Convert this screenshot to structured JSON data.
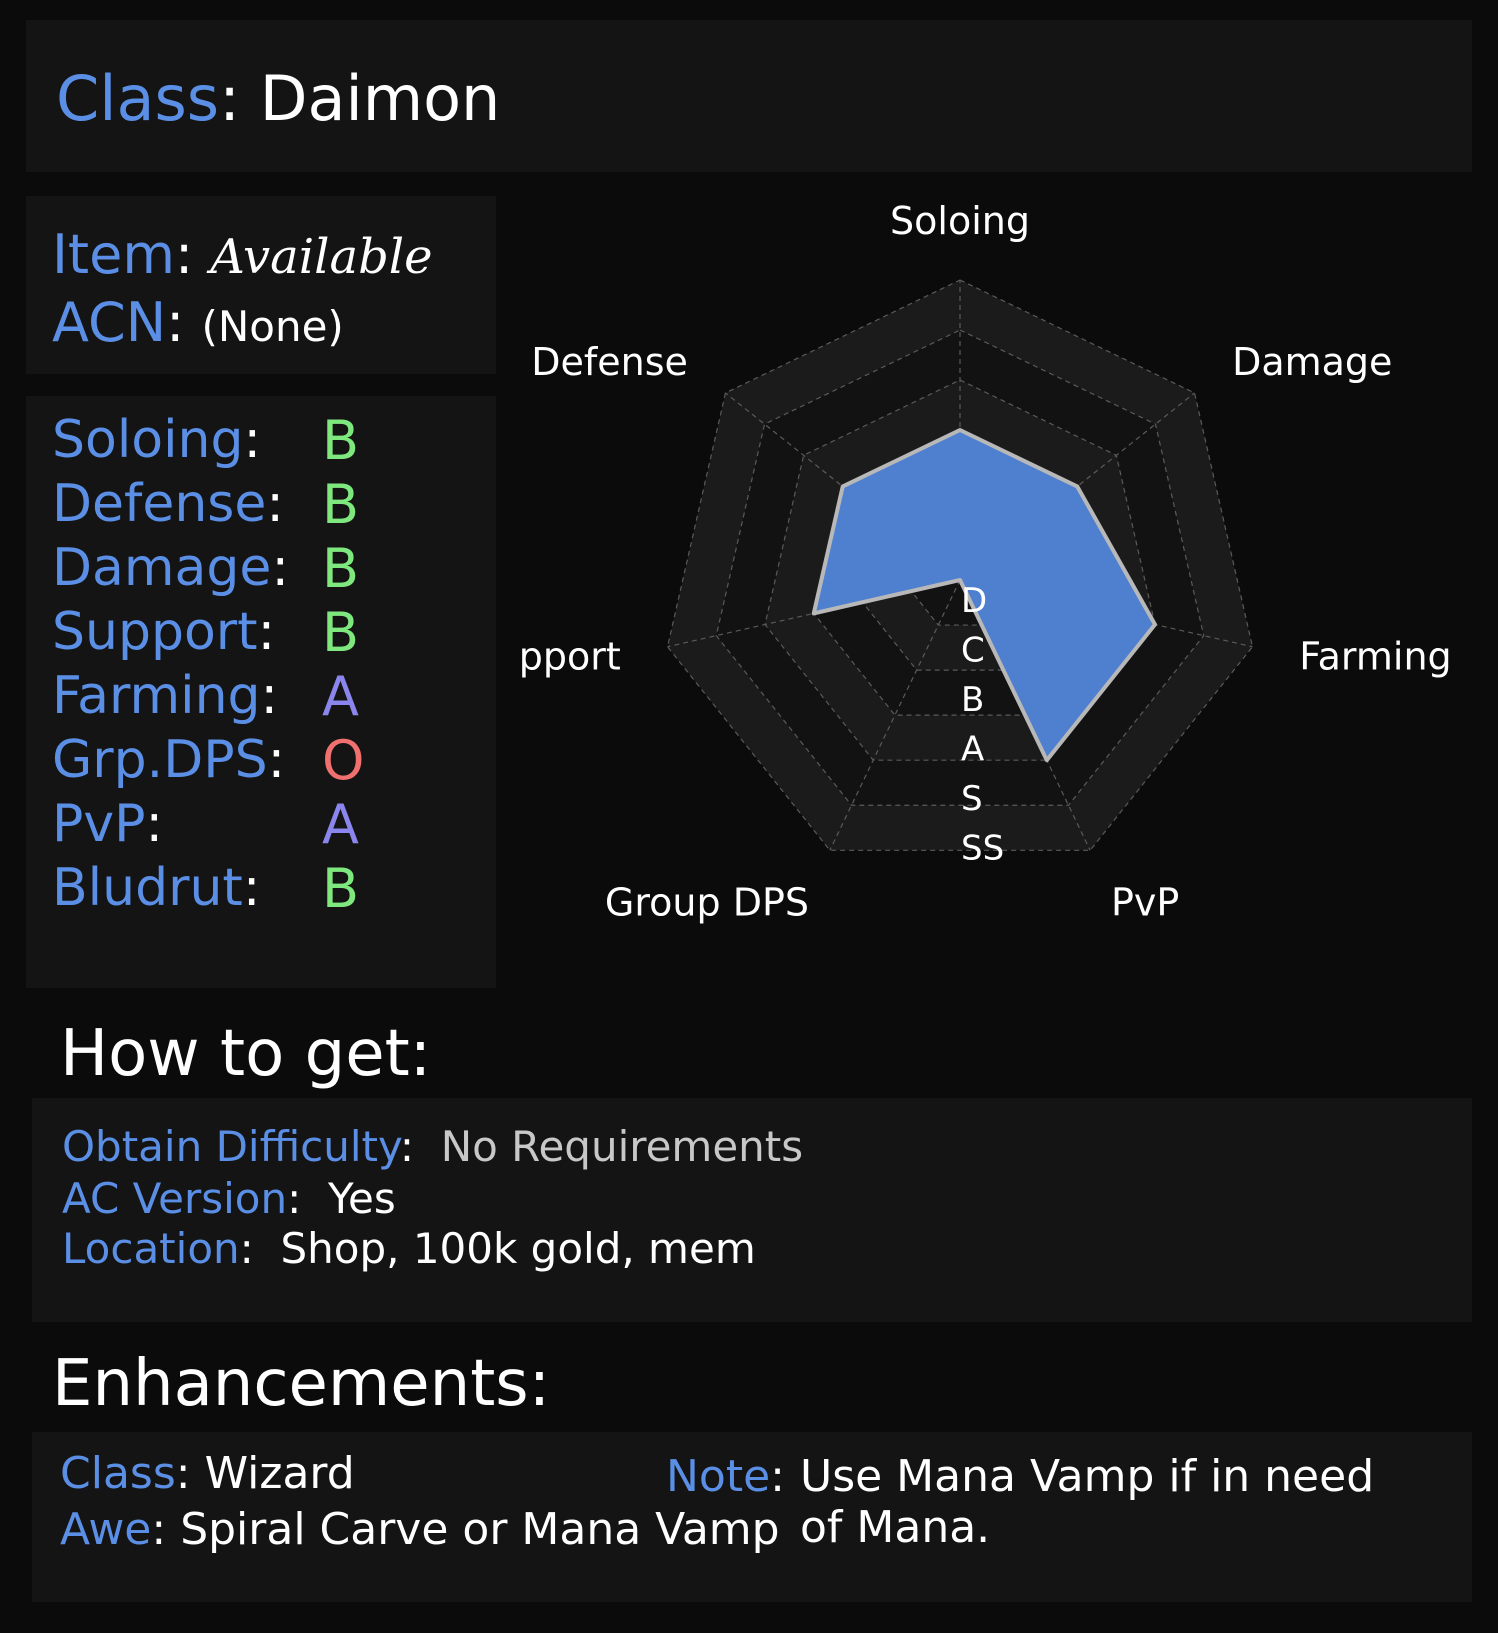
{
  "header": {
    "class_label": "Class",
    "class_value": "Daimon"
  },
  "item": {
    "item_label": "Item",
    "item_value": "Available",
    "acn_label": "ACN",
    "acn_value": "(None)"
  },
  "ratings": [
    {
      "label": "Soloing",
      "grade": "B",
      "color": "#7ee87e"
    },
    {
      "label": "Defense",
      "grade": "B",
      "color": "#7ee87e"
    },
    {
      "label": "Damage",
      "grade": "B",
      "color": "#7ee87e"
    },
    {
      "label": "Support",
      "grade": "B",
      "color": "#7ee87e"
    },
    {
      "label": "Farming",
      "grade": "A",
      "color": "#8a86ee"
    },
    {
      "label": "Grp.DPS",
      "grade": "O",
      "color": "#f07070"
    },
    {
      "label": "PvP",
      "grade": "A",
      "color": "#8a86ee"
    },
    {
      "label": "Bludrut",
      "grade": "B",
      "color": "#7ee87e"
    }
  ],
  "chart_data": {
    "type": "radar",
    "axes": [
      "Soloing",
      "Damage",
      "Farming",
      "PvP",
      "Group DPS",
      "Support",
      "Defense"
    ],
    "scale_labels": [
      "D",
      "C",
      "B",
      "A",
      "S",
      "SS"
    ],
    "values": [
      3,
      3,
      4,
      4,
      0,
      3,
      3
    ],
    "max": 6,
    "fill_color": "#4f7fcf",
    "line_color": "#b8b8b8"
  },
  "how_to_get": {
    "title": "How to get:",
    "obtain_label": "Obtain Difficulty",
    "obtain_value": "No Requirements",
    "ac_label": "AC Version",
    "ac_value": "Yes",
    "location_label": "Location",
    "location_value": "Shop, 100k gold, mem"
  },
  "enhancements": {
    "title": "Enhancements:",
    "class_label": "Class",
    "class_value": "Wizard",
    "awe_label": "Awe",
    "awe_value": "Spiral Carve or Mana Vamp",
    "note_label": "Note",
    "note_value": "Use Mana Vamp if in need of Mana."
  }
}
